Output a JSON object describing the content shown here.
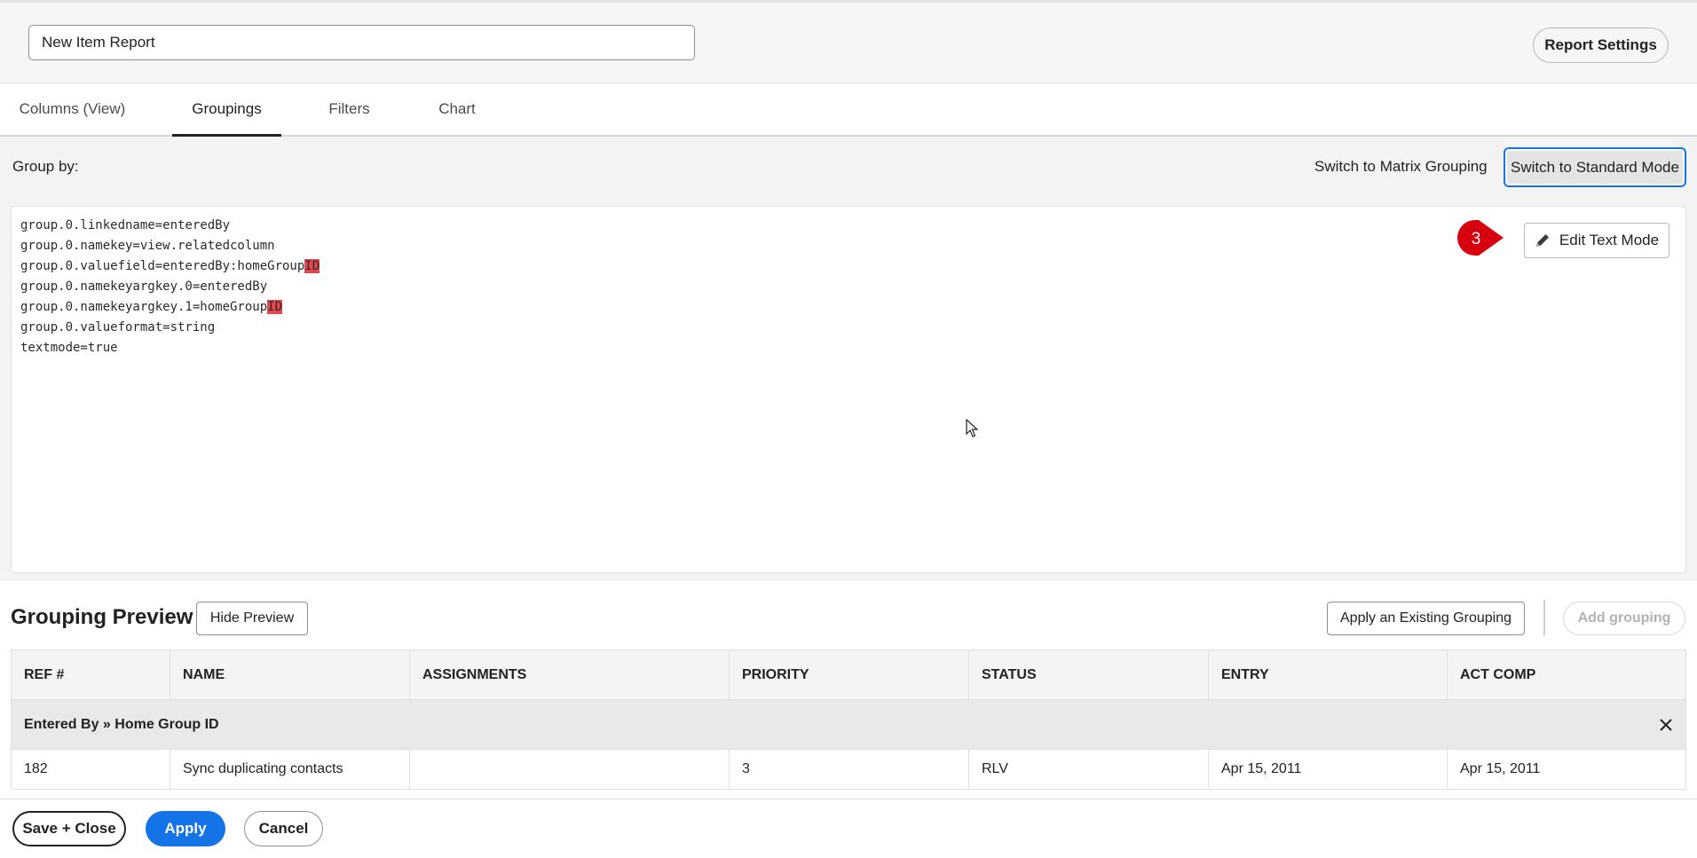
{
  "header": {
    "report_title_value": "New Item Report",
    "report_settings_label": "Report Settings"
  },
  "tabs": [
    {
      "label": "Columns (View)",
      "active": false
    },
    {
      "label": "Groupings",
      "active": true
    },
    {
      "label": "Filters",
      "active": false
    },
    {
      "label": "Chart",
      "active": false
    }
  ],
  "groupings": {
    "group_by_label": "Group by:",
    "switch_matrix_label": "Switch to Matrix Grouping",
    "switch_standard_label": "Switch to Standard Mode",
    "edit_text_mode_label": "Edit Text Mode",
    "step_badge": "3",
    "code_lines": [
      {
        "text": "group.0.linkedname=enteredBy",
        "highlight": ""
      },
      {
        "text": "group.0.namekey=view.relatedcolumn",
        "highlight": ""
      },
      {
        "text": "group.0.valuefield=enteredBy:homeGroup",
        "highlight": "ID"
      },
      {
        "text": "group.0.namekeyargkey.0=enteredBy",
        "highlight": ""
      },
      {
        "text": "group.0.namekeyargkey.1=homeGroup",
        "highlight": "ID"
      },
      {
        "text": "group.0.valueformat=string",
        "highlight": ""
      },
      {
        "text": "textmode=true",
        "highlight": ""
      }
    ]
  },
  "preview": {
    "title": "Grouping Preview",
    "hide_preview_label": "Hide Preview",
    "apply_existing_label": "Apply an Existing Grouping",
    "add_grouping_label": "Add grouping",
    "columns": [
      "REF #",
      "NAME",
      "ASSIGNMENTS",
      "PRIORITY",
      "STATUS",
      "ENTRY",
      "ACT COMP"
    ],
    "group_header": "Entered By » Home Group ID",
    "rows": [
      [
        "182",
        "Sync duplicating contacts",
        "",
        "3",
        "RLV",
        "Apr 15, 2011",
        "Apr 15, 2011"
      ]
    ]
  },
  "footer": {
    "save_close_label": "Save + Close",
    "apply_label": "Apply",
    "cancel_label": "Cancel"
  },
  "colors": {
    "accent_blue": "#1473e6",
    "highlight_red": "#e34850",
    "badge_red": "#d7000f"
  }
}
